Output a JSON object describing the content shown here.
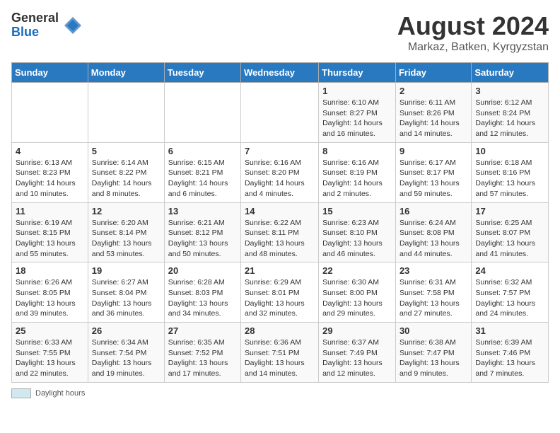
{
  "logo": {
    "general": "General",
    "blue": "Blue"
  },
  "header": {
    "title": "August 2024",
    "subtitle": "Markaz, Batken, Kyrgyzstan"
  },
  "weekdays": [
    "Sunday",
    "Monday",
    "Tuesday",
    "Wednesday",
    "Thursday",
    "Friday",
    "Saturday"
  ],
  "weeks": [
    [
      {
        "day": "",
        "info": ""
      },
      {
        "day": "",
        "info": ""
      },
      {
        "day": "",
        "info": ""
      },
      {
        "day": "",
        "info": ""
      },
      {
        "day": "1",
        "info": "Sunrise: 6:10 AM\nSunset: 8:27 PM\nDaylight: 14 hours and 16 minutes."
      },
      {
        "day": "2",
        "info": "Sunrise: 6:11 AM\nSunset: 8:26 PM\nDaylight: 14 hours and 14 minutes."
      },
      {
        "day": "3",
        "info": "Sunrise: 6:12 AM\nSunset: 8:24 PM\nDaylight: 14 hours and 12 minutes."
      }
    ],
    [
      {
        "day": "4",
        "info": "Sunrise: 6:13 AM\nSunset: 8:23 PM\nDaylight: 14 hours and 10 minutes."
      },
      {
        "day": "5",
        "info": "Sunrise: 6:14 AM\nSunset: 8:22 PM\nDaylight: 14 hours and 8 minutes."
      },
      {
        "day": "6",
        "info": "Sunrise: 6:15 AM\nSunset: 8:21 PM\nDaylight: 14 hours and 6 minutes."
      },
      {
        "day": "7",
        "info": "Sunrise: 6:16 AM\nSunset: 8:20 PM\nDaylight: 14 hours and 4 minutes."
      },
      {
        "day": "8",
        "info": "Sunrise: 6:16 AM\nSunset: 8:19 PM\nDaylight: 14 hours and 2 minutes."
      },
      {
        "day": "9",
        "info": "Sunrise: 6:17 AM\nSunset: 8:17 PM\nDaylight: 13 hours and 59 minutes."
      },
      {
        "day": "10",
        "info": "Sunrise: 6:18 AM\nSunset: 8:16 PM\nDaylight: 13 hours and 57 minutes."
      }
    ],
    [
      {
        "day": "11",
        "info": "Sunrise: 6:19 AM\nSunset: 8:15 PM\nDaylight: 13 hours and 55 minutes."
      },
      {
        "day": "12",
        "info": "Sunrise: 6:20 AM\nSunset: 8:14 PM\nDaylight: 13 hours and 53 minutes."
      },
      {
        "day": "13",
        "info": "Sunrise: 6:21 AM\nSunset: 8:12 PM\nDaylight: 13 hours and 50 minutes."
      },
      {
        "day": "14",
        "info": "Sunrise: 6:22 AM\nSunset: 8:11 PM\nDaylight: 13 hours and 48 minutes."
      },
      {
        "day": "15",
        "info": "Sunrise: 6:23 AM\nSunset: 8:10 PM\nDaylight: 13 hours and 46 minutes."
      },
      {
        "day": "16",
        "info": "Sunrise: 6:24 AM\nSunset: 8:08 PM\nDaylight: 13 hours and 44 minutes."
      },
      {
        "day": "17",
        "info": "Sunrise: 6:25 AM\nSunset: 8:07 PM\nDaylight: 13 hours and 41 minutes."
      }
    ],
    [
      {
        "day": "18",
        "info": "Sunrise: 6:26 AM\nSunset: 8:05 PM\nDaylight: 13 hours and 39 minutes."
      },
      {
        "day": "19",
        "info": "Sunrise: 6:27 AM\nSunset: 8:04 PM\nDaylight: 13 hours and 36 minutes."
      },
      {
        "day": "20",
        "info": "Sunrise: 6:28 AM\nSunset: 8:03 PM\nDaylight: 13 hours and 34 minutes."
      },
      {
        "day": "21",
        "info": "Sunrise: 6:29 AM\nSunset: 8:01 PM\nDaylight: 13 hours and 32 minutes."
      },
      {
        "day": "22",
        "info": "Sunrise: 6:30 AM\nSunset: 8:00 PM\nDaylight: 13 hours and 29 minutes."
      },
      {
        "day": "23",
        "info": "Sunrise: 6:31 AM\nSunset: 7:58 PM\nDaylight: 13 hours and 27 minutes."
      },
      {
        "day": "24",
        "info": "Sunrise: 6:32 AM\nSunset: 7:57 PM\nDaylight: 13 hours and 24 minutes."
      }
    ],
    [
      {
        "day": "25",
        "info": "Sunrise: 6:33 AM\nSunset: 7:55 PM\nDaylight: 13 hours and 22 minutes."
      },
      {
        "day": "26",
        "info": "Sunrise: 6:34 AM\nSunset: 7:54 PM\nDaylight: 13 hours and 19 minutes."
      },
      {
        "day": "27",
        "info": "Sunrise: 6:35 AM\nSunset: 7:52 PM\nDaylight: 13 hours and 17 minutes."
      },
      {
        "day": "28",
        "info": "Sunrise: 6:36 AM\nSunset: 7:51 PM\nDaylight: 13 hours and 14 minutes."
      },
      {
        "day": "29",
        "info": "Sunrise: 6:37 AM\nSunset: 7:49 PM\nDaylight: 13 hours and 12 minutes."
      },
      {
        "day": "30",
        "info": "Sunrise: 6:38 AM\nSunset: 7:47 PM\nDaylight: 13 hours and 9 minutes."
      },
      {
        "day": "31",
        "info": "Sunrise: 6:39 AM\nSunset: 7:46 PM\nDaylight: 13 hours and 7 minutes."
      }
    ]
  ],
  "footer": {
    "swatch_label": "Daylight hours"
  }
}
